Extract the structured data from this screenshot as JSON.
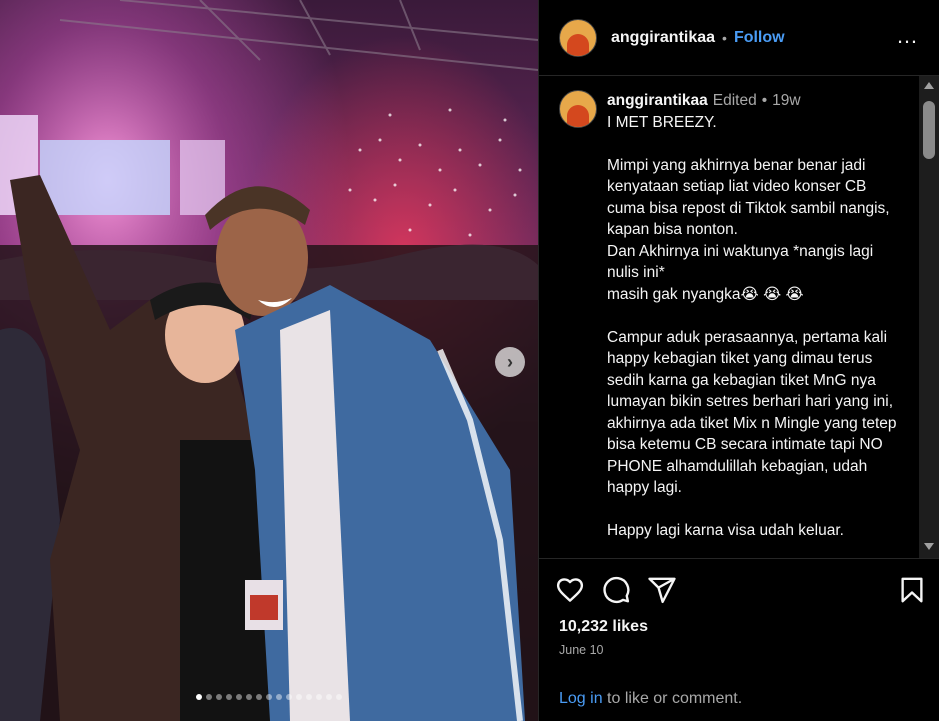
{
  "header": {
    "username": "anggirantikaa",
    "separator": "•",
    "follow_label": "Follow",
    "more_icon": "…"
  },
  "caption": {
    "username": "anggirantikaa",
    "edited_label": "Edited",
    "separator": "•",
    "age": "19w",
    "text": "I MET BREEZY.\n\nMimpi yang akhirnya benar benar jadi kenyataan setiap liat video konser CB cuma bisa repost di Tiktok sambil nangis, kapan bisa nonton.\nDan Akhirnya ini waktunya *nangis lagi nulis ini*\nmasih gak nyangka😭 😭 😭\n\nCampur aduk perasaannya, pertama kali happy kebagian tiket yang dimau terus sedih karna ga kebagian tiket MnG nya lumayan bikin setres berhari hari yang ini, akhirnya ada tiket Mix n Mingle yang tetep bisa ketemu CB secara intimate tapi NO PHONE alhamdulillah kebagian, udah happy lagi.\n\nHappy lagi karna visa udah keluar."
  },
  "media": {
    "next_arrow": "›",
    "carousel": {
      "count": 15,
      "active": 0
    }
  },
  "footer": {
    "likes": "10,232 likes",
    "date": "June 10",
    "login_link": "Log in",
    "login_rest": " to like or comment."
  },
  "colors": {
    "accent": "#4a9cf5",
    "background": "#000000",
    "muted": "#a8a8a8"
  },
  "icons": [
    "more-icon",
    "heart-icon",
    "comment-icon",
    "share-icon",
    "bookmark-icon",
    "chevron-right-icon"
  ]
}
